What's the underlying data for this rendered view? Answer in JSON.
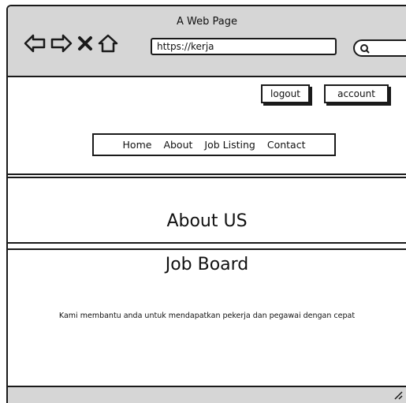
{
  "window": {
    "title": "A Web Page"
  },
  "browser": {
    "url": "https://kerja",
    "icons": [
      "back-arrow-icon",
      "forward-arrow-icon",
      "close-icon",
      "home-icon",
      "search-icon"
    ]
  },
  "header": {
    "logout_label": "logout",
    "account_label": "account",
    "menu": [
      {
        "label": "Home"
      },
      {
        "label": "About"
      },
      {
        "label": "Job Listing"
      },
      {
        "label": "Contact"
      }
    ]
  },
  "about": {
    "title": "About US"
  },
  "board": {
    "title": "Job Board",
    "description": "Kami membantu anda untuk mendapatkan pekerja dan pegawai dengan cepat"
  }
}
